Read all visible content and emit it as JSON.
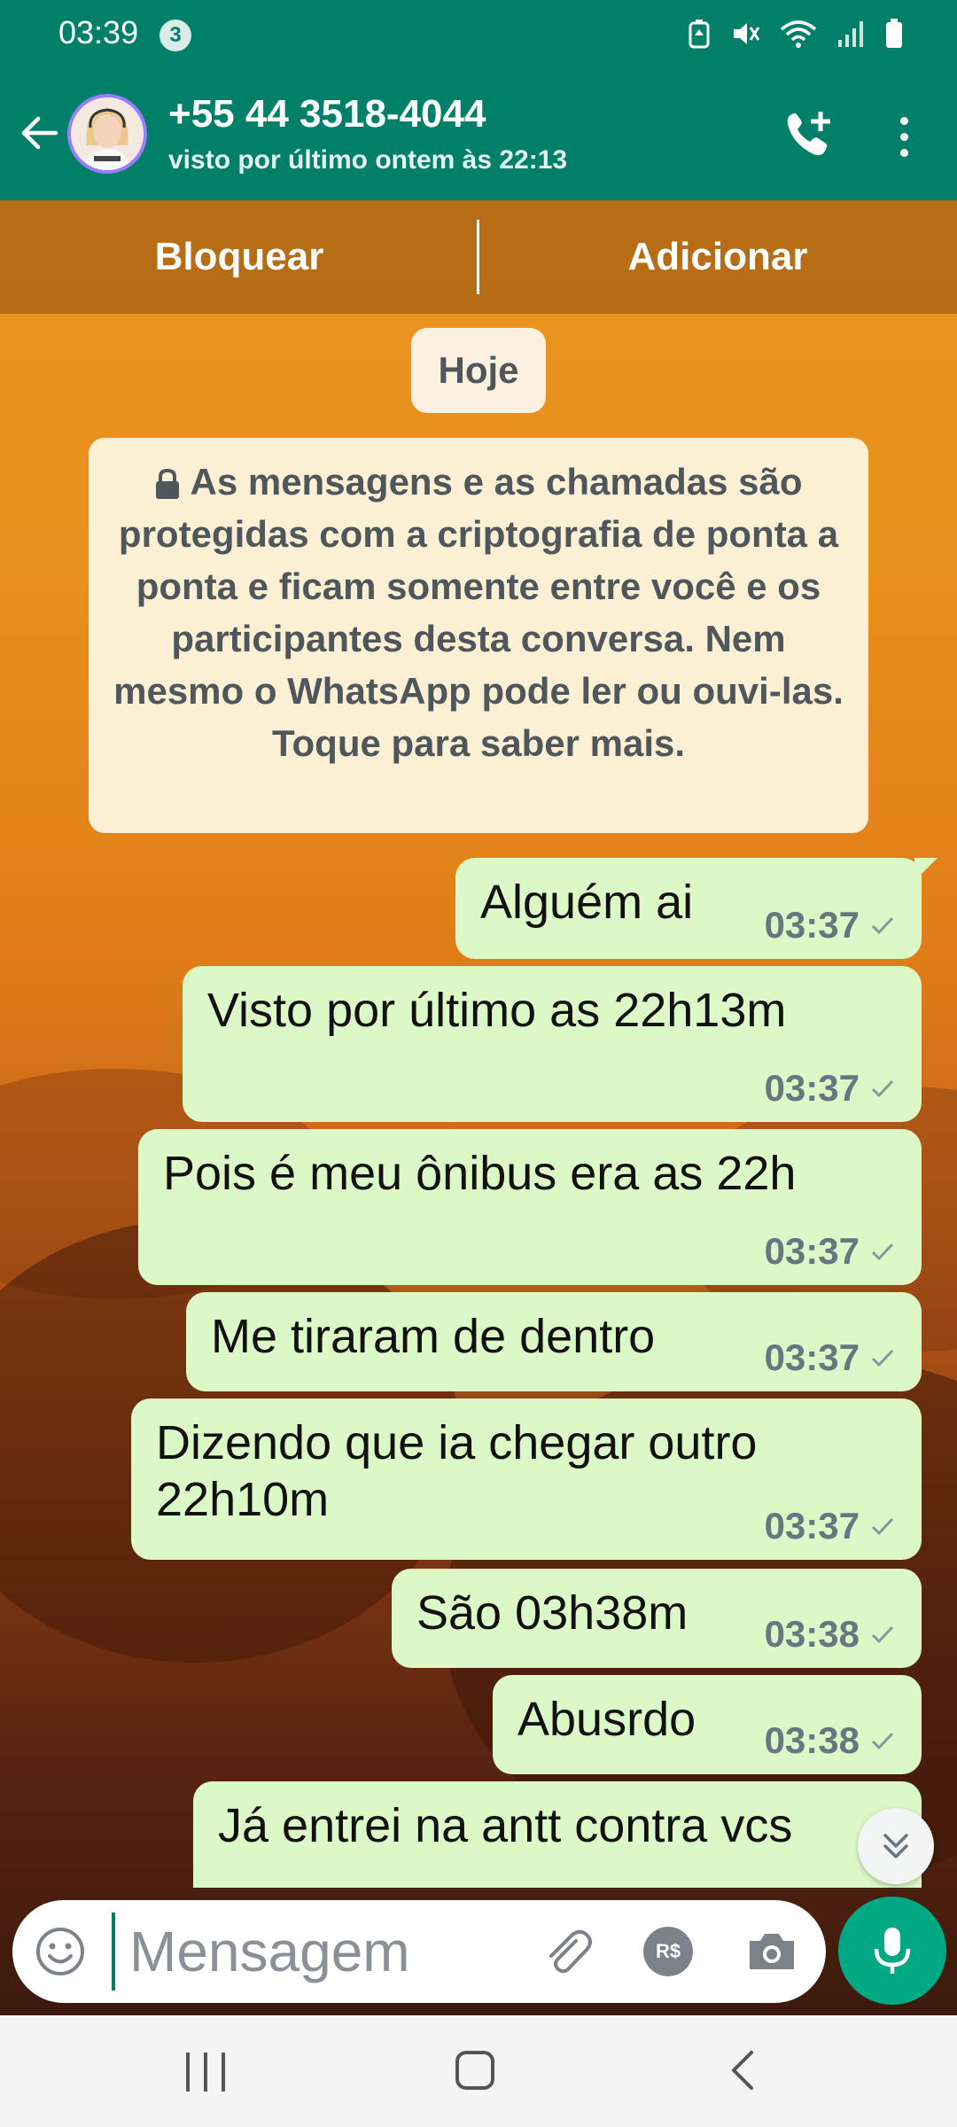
{
  "status_bar": {
    "time": "03:39",
    "notif_count": "3"
  },
  "header": {
    "name": "+55 44 3518-4044",
    "status": "visto por último ontem às 22:13"
  },
  "actions": {
    "block": "Bloquear",
    "add": "Adicionar"
  },
  "date_chip": "Hoje",
  "encryption_notice": "As mensagens e as chamadas são protegidas com a criptografia de ponta a ponta e ficam somente entre você e os participantes desta conversa. Nem mesmo o WhatsApp pode ler ou ouvi-las. Toque para saber mais.",
  "messages": [
    {
      "text": "Alguém ai",
      "time": "03:37"
    },
    {
      "text": "Visto por último as 22h13m",
      "time": "03:37"
    },
    {
      "text": "Pois é meu ônibus era as 22h",
      "time": "03:37"
    },
    {
      "text": "Me tiraram de dentro",
      "time": "03:37"
    },
    {
      "text": "Dizendo que ia chegar outro\n22h10m",
      "time": "03:37"
    },
    {
      "text": "São 03h38m",
      "time": "03:38"
    },
    {
      "text": "Abusrdo",
      "time": "03:38"
    },
    {
      "text": "Já entrei na antt contra vcs",
      "time": ""
    }
  ],
  "composer": {
    "placeholder": "Mensagem",
    "pay_label": "R$"
  },
  "colors": {
    "header": "#008069",
    "bubble_out": "#dcf8c6",
    "accent": "#00a884"
  },
  "icons": [
    "back-arrow-icon",
    "add-call-icon",
    "more-vert-icon",
    "lock-icon",
    "check-icon",
    "chevron-double-down-icon",
    "emoji-icon",
    "attach-icon",
    "payment-icon",
    "camera-icon",
    "mic-icon"
  ]
}
